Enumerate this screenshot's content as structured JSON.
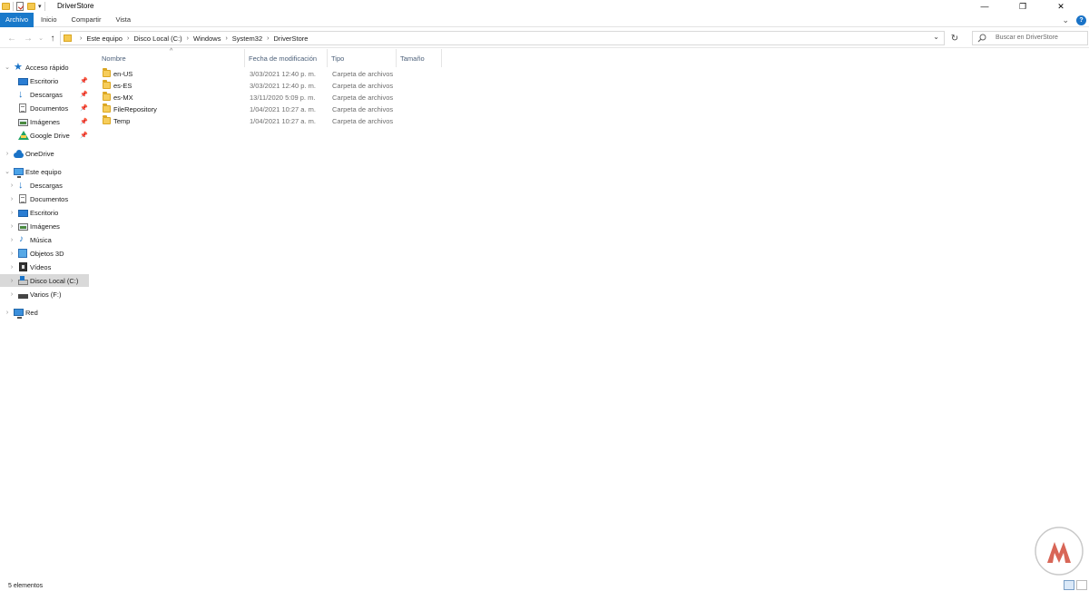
{
  "window": {
    "title": "DriverStore",
    "controls": [
      "minimize",
      "restore",
      "close"
    ]
  },
  "ribbon": {
    "tabs": [
      {
        "label": "Archivo",
        "active": true
      },
      {
        "label": "Inicio"
      },
      {
        "label": "Compartir"
      },
      {
        "label": "Vista"
      }
    ]
  },
  "address": {
    "crumbs": [
      "Este equipo",
      "Disco Local (C:)",
      "Windows",
      "System32",
      "DriverStore"
    ]
  },
  "search": {
    "placeholder": "Buscar en DriverStore"
  },
  "sidebar": {
    "quick_access": {
      "label": "Acceso rápido",
      "items": [
        {
          "label": "Escritorio",
          "icon": "desktop-icon",
          "pinned": true
        },
        {
          "label": "Descargas",
          "icon": "download-icon",
          "pinned": true
        },
        {
          "label": "Documentos",
          "icon": "document-icon",
          "pinned": true
        },
        {
          "label": "Imágenes",
          "icon": "pictures-icon",
          "pinned": true
        },
        {
          "label": "Google Drive",
          "icon": "google-drive-icon",
          "pinned": true
        }
      ]
    },
    "onedrive": {
      "label": "OneDrive"
    },
    "this_pc": {
      "label": "Este equipo",
      "items": [
        {
          "label": "Descargas",
          "icon": "download-icon"
        },
        {
          "label": "Documentos",
          "icon": "document-icon"
        },
        {
          "label": "Escritorio",
          "icon": "desktop-icon"
        },
        {
          "label": "Imágenes",
          "icon": "pictures-icon"
        },
        {
          "label": "Música",
          "icon": "music-icon"
        },
        {
          "label": "Objetos 3D",
          "icon": "3d-objects-icon"
        },
        {
          "label": "Vídeos",
          "icon": "videos-icon"
        },
        {
          "label": "Disco Local (C:)",
          "icon": "local-disk-icon",
          "selected": true
        },
        {
          "label": "Varios (F:)",
          "icon": "drive-icon"
        }
      ]
    },
    "network": {
      "label": "Red"
    }
  },
  "columns": {
    "name": "Nombre",
    "date": "Fecha de modificación",
    "type": "Tipo",
    "size": "Tamaño"
  },
  "files": [
    {
      "name": "en-US",
      "date": "3/03/2021 12:40 p. m.",
      "type": "Carpeta de archivos"
    },
    {
      "name": "es-ES",
      "date": "3/03/2021 12:40 p. m.",
      "type": "Carpeta de archivos"
    },
    {
      "name": "es-MX",
      "date": "13/11/2020 5:09 p. m.",
      "type": "Carpeta de archivos"
    },
    {
      "name": "FileRepository",
      "date": "1/04/2021 10:27 a. m.",
      "type": "Carpeta de archivos"
    },
    {
      "name": "Temp",
      "date": "1/04/2021 10:27 a. m.",
      "type": "Carpeta de archivos"
    }
  ],
  "status": {
    "count": "5 elementos"
  },
  "colors": {
    "accent": "#1979ca",
    "folder": "#f6cd5b",
    "selected_nav": "#d9d9d9"
  }
}
